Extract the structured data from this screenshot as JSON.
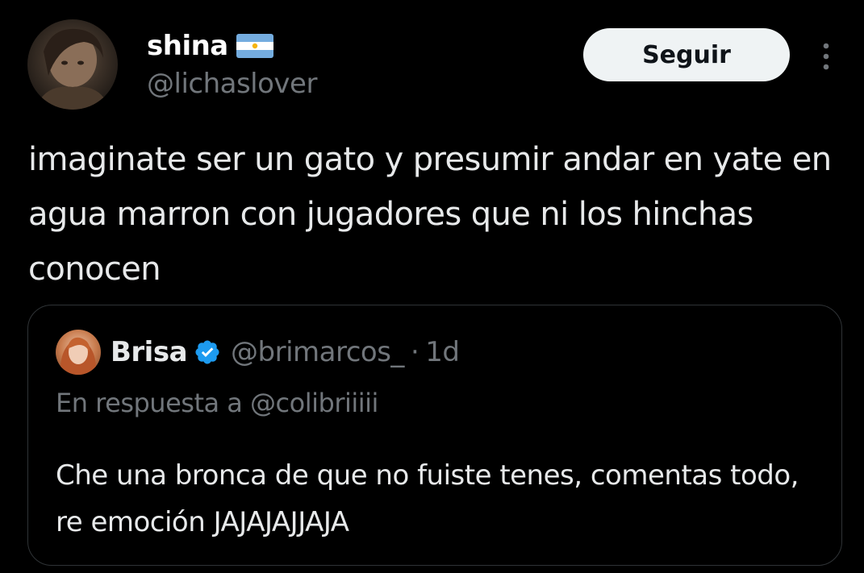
{
  "tweet": {
    "author": {
      "display_name": "shina",
      "flag_emoji": "🇦🇷",
      "handle": "@lichaslover",
      "avatar_icon": "profile-photo"
    },
    "follow_label": "Seguir",
    "more_icon": "more-options-icon",
    "text": "imaginate ser un gato y presumir andar en yate en agua marron con jugadores que ni los hinchas conocen"
  },
  "quoted_tweet": {
    "author": {
      "display_name": "Brisa",
      "verified": true,
      "handle": "@brimarcos_",
      "avatar_icon": "profile-photo"
    },
    "separator": "·",
    "time": "1d",
    "reply_to": "En respuesta a @colibriiiii",
    "text": "Che una bronca de que no fuiste tenes, comentas todo, re emoción JAJAJAJJAJA"
  },
  "colors": {
    "background": "#000000",
    "text_primary": "#e7e9ea",
    "text_secondary": "#71767b",
    "button_bg": "#eff3f4",
    "verified_blue": "#1d9bf0",
    "border": "#2f3336"
  }
}
